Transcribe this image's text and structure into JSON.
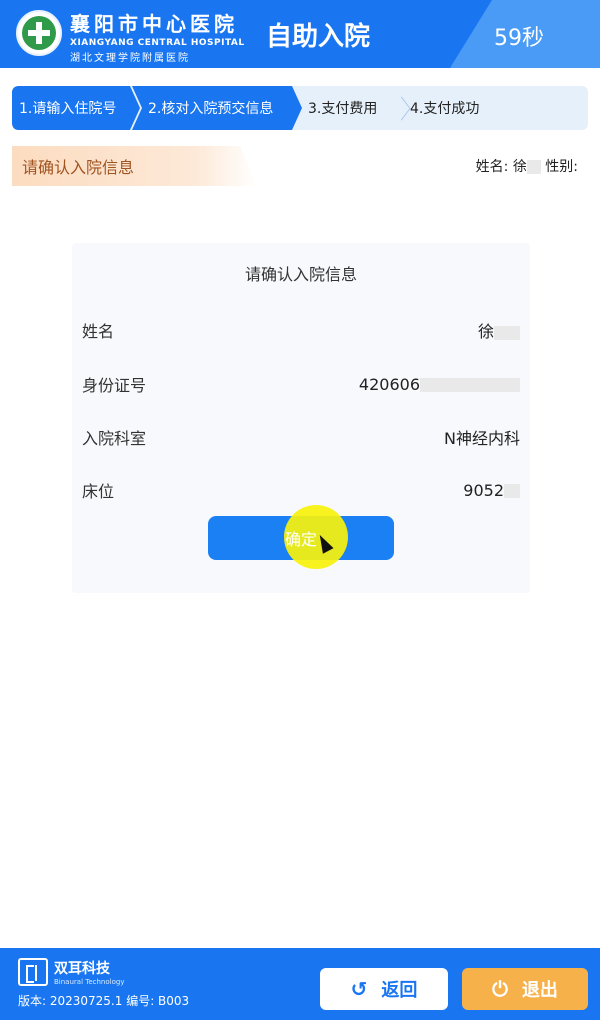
{
  "header": {
    "hospital_cn": "襄阳市中心医院",
    "hospital_en": "XIANGYANG CENTRAL HOSPITAL",
    "hospital_sub": "湖北文理学院附属医院",
    "title": "自助入院",
    "countdown": "59秒"
  },
  "steps": [
    {
      "label": "1.请输入住院号"
    },
    {
      "label": "2.核对入院预交信息"
    },
    {
      "label": "3.支付费用"
    },
    {
      "label": "4.支付成功"
    }
  ],
  "section": {
    "title": "请确认入院信息",
    "name_label": "姓名: 徐",
    "gender_label": "性别:"
  },
  "card": {
    "title": "请确认入院信息",
    "rows": [
      {
        "label": "姓名",
        "value": "徐"
      },
      {
        "label": "身份证号",
        "value": "420606"
      },
      {
        "label": "入院科室",
        "value": "N神经内科"
      },
      {
        "label": "床位",
        "value": "9052"
      }
    ],
    "confirm_label": "确定"
  },
  "footer": {
    "brand_cn": "双耳科技",
    "brand_en": "Binaural Technology",
    "version": "版本: 20230725.1  编号: B003",
    "back_label": "返回",
    "exit_label": "退出"
  },
  "icons": {
    "back": "undo-arrow-icon",
    "exit": "power-icon"
  },
  "colors": {
    "primary": "#1976f0",
    "accent_orange": "#f6b14b",
    "section_text": "#a05422"
  }
}
